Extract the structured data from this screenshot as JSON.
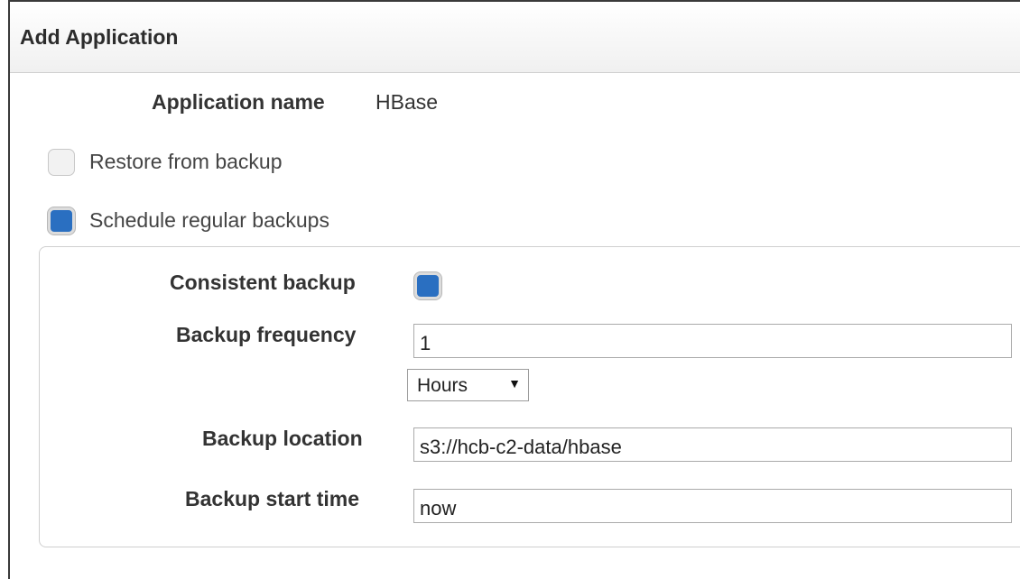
{
  "dialog": {
    "title": "Add Application",
    "application_name_label": "Application name",
    "application_name_value": "HBase",
    "restore_from_backup": {
      "label": "Restore from backup",
      "checked": false
    },
    "schedule_regular_backups": {
      "label": "Schedule regular backups",
      "checked": true
    },
    "backup_settings": {
      "consistent_backup_label": "Consistent backup",
      "consistent_backup_checked": true,
      "frequency_label": "Backup frequency",
      "frequency_value": "1",
      "frequency_unit": "Hours",
      "location_label": "Backup location",
      "location_value": "s3://hcb-c2-data/hbase",
      "start_time_label": "Backup start time",
      "start_time_value": "now"
    }
  },
  "colors": {
    "checkbox_checked": "#2a6fc1",
    "border": "#cfcfcf"
  },
  "icons": {
    "select_arrow": "caret-down-icon"
  }
}
